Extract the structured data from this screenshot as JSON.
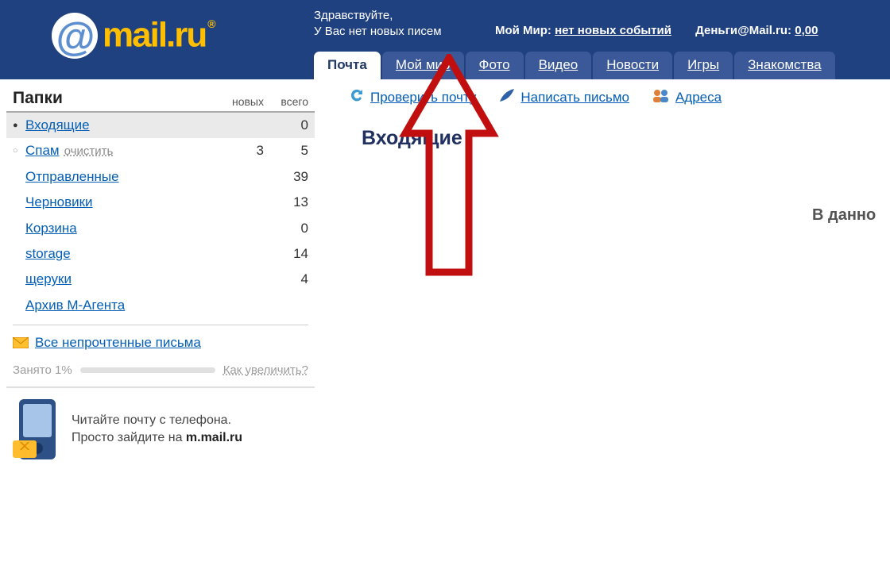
{
  "header": {
    "logo_text": "mail.ru",
    "greeting_line1": "Здравствуйте,",
    "greeting_line2": "У Вас нет новых писем",
    "moymir_label": "Мой Мир:",
    "moymir_value": "нет новых событий",
    "money_label": "Деньги@Mail.ru:",
    "money_value": "0,00"
  },
  "tabs": [
    {
      "label": "Почта",
      "active": true
    },
    {
      "label": "Мой мир"
    },
    {
      "label": "Фото"
    },
    {
      "label": "Видео"
    },
    {
      "label": "Новости"
    },
    {
      "label": "Игры"
    },
    {
      "label": "Знакомства"
    }
  ],
  "sidebar": {
    "title": "Папки",
    "col_new": "новых",
    "col_total": "всего",
    "folders": [
      {
        "name": "Входящие",
        "new": "",
        "total": "0",
        "selected": true,
        "bullet": "full"
      },
      {
        "name": "Спам",
        "clear": "очистить",
        "new": "3",
        "total": "5",
        "bullet": "empty"
      },
      {
        "name": "Отправленные",
        "new": "",
        "total": "39"
      },
      {
        "name": "Черновики",
        "new": "",
        "total": "13"
      },
      {
        "name": "Корзина",
        "new": "",
        "total": "0"
      },
      {
        "name": "storage",
        "new": "",
        "total": "14"
      },
      {
        "name": "щеруки",
        "new": "",
        "total": "4"
      },
      {
        "name": "Архив М-Агента",
        "new": "",
        "total": ""
      }
    ],
    "unread": "Все непрочтенные письма",
    "used_label": "Занято 1%",
    "used_more": "Как увеличить?",
    "promo_line1": "Читайте почту с телефона.",
    "promo_line2_a": "Просто зайдите на ",
    "promo_line2_b": "m.mail.ru"
  },
  "toolbar": {
    "check": "Проверить почту",
    "compose": "Написать письмо",
    "contacts": "Адреса"
  },
  "main": {
    "title": "Входящие",
    "empty_text": "В данно"
  }
}
